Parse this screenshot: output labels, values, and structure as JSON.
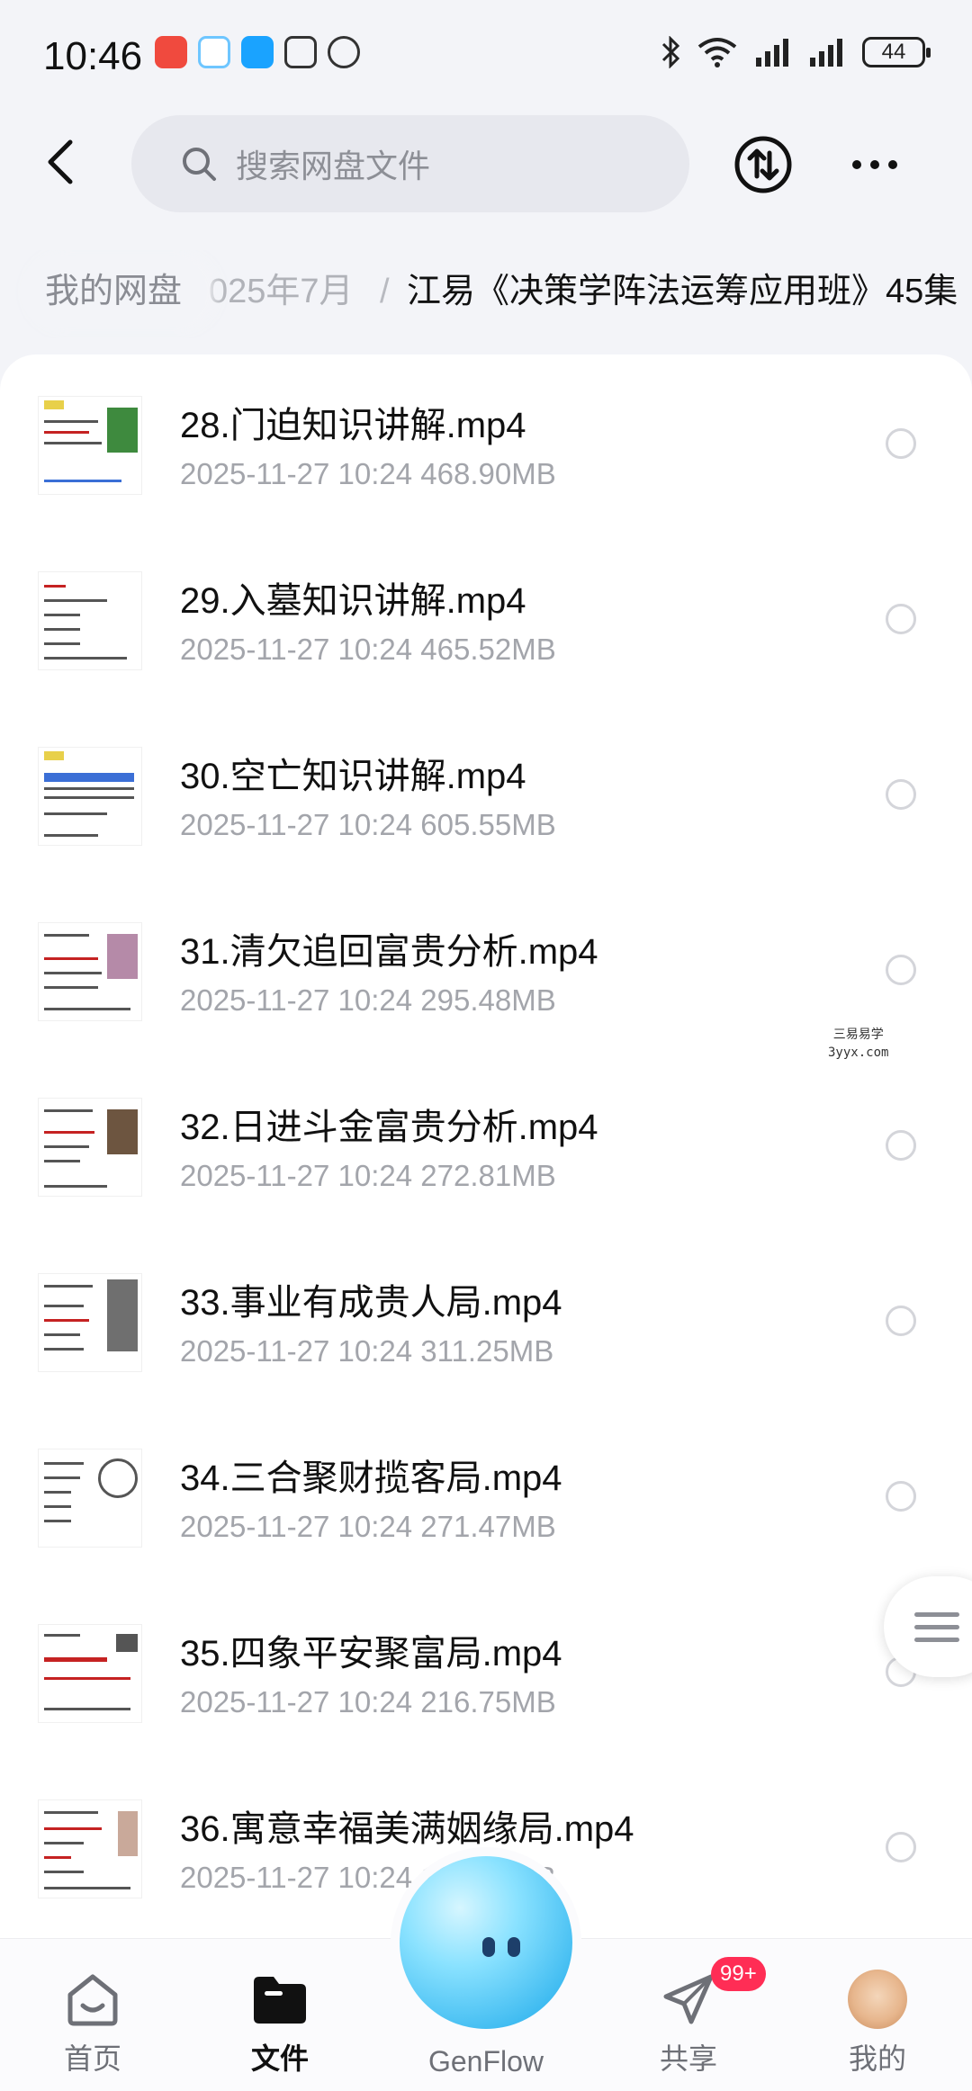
{
  "status_bar": {
    "time": "10:46",
    "battery": "44"
  },
  "header": {
    "search_placeholder": "搜索网盘文件"
  },
  "breadcrumb": {
    "home": "我的网盘",
    "middle": "025年7月",
    "separator": "/",
    "current": "江易《决策学阵法运筹应用班》45集"
  },
  "files": [
    {
      "name": "28.门迫知识讲解.mp4",
      "meta": "2025-11-27  10:24  468.90MB"
    },
    {
      "name": "29.入墓知识讲解.mp4",
      "meta": "2025-11-27  10:24  465.52MB"
    },
    {
      "name": "30.空亡知识讲解.mp4",
      "meta": "2025-11-27  10:24  605.55MB"
    },
    {
      "name": "31.清欠追回富贵分析.mp4",
      "meta": "2025-11-27  10:24  295.48MB"
    },
    {
      "name": "32.日进斗金富贵分析.mp4",
      "meta": "2025-11-27  10:24  272.81MB"
    },
    {
      "name": "33.事业有成贵人局.mp4",
      "meta": "2025-11-27  10:24  311.25MB"
    },
    {
      "name": "34.三合聚财揽客局.mp4",
      "meta": "2025-11-27  10:24  271.47MB"
    },
    {
      "name": "35.四象平安聚富局.mp4",
      "meta": "2025-11-27  10:24  216.75MB"
    },
    {
      "name": "36.寓意幸福美满姻缘局.mp4",
      "meta": "2025-11-27  10:24  178.38MB"
    }
  ],
  "watermark": {
    "line1": "三易易学",
    "line2": "3yyx.com"
  },
  "nav": {
    "home": "首页",
    "files": "文件",
    "genflow": "GenFlow",
    "share": "共享",
    "share_badge": "99+",
    "mine": "我的"
  },
  "colors": {
    "accent": "#111111",
    "badge": "#ff2d55",
    "genflow": "#3bb9f0"
  }
}
